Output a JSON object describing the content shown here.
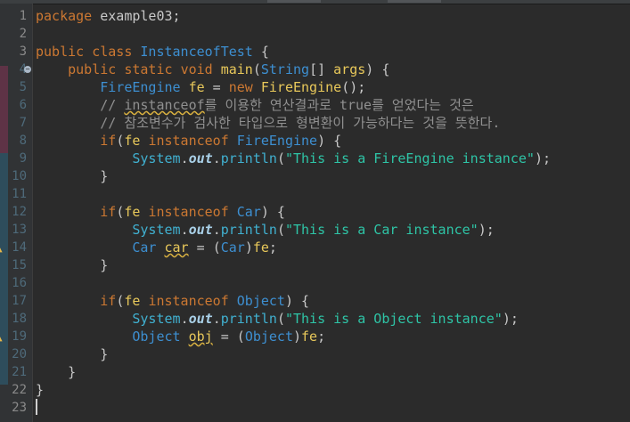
{
  "editor": {
    "line_numbers": [
      "1",
      "2",
      "3",
      "4",
      "5",
      "6",
      "7",
      "8",
      "9",
      "10",
      "11",
      "12",
      "13",
      "14",
      "15",
      "16",
      "17",
      "18",
      "19",
      "20",
      "21",
      "22",
      "23"
    ],
    "lines": {
      "l1": {
        "kw": "package",
        "rest": " example03;"
      },
      "l3": {
        "kw1": "public",
        "kw2": "class",
        "cls": "InstanceofTest",
        "rest": " {"
      },
      "l4": {
        "kw1": "public",
        "kw2": "static",
        "kw3": "void",
        "mth": "main",
        "p1": "(",
        "cls": "String",
        "p2": "[] ",
        "arg": "args",
        "p3": ") {"
      },
      "l5": {
        "cls": "FireEngine",
        "var": "fe",
        "eq": " = ",
        "kw": "new",
        "cls2": "FireEngine",
        "rest": "();"
      },
      "l6": {
        "c1": "// ",
        "c2": "instanceof",
        "c3": "를 이용한 연산결과로 true를 얻었다는 것은"
      },
      "l7": {
        "c": "// 참조변수가 검사한 타입으로 형변환이 가능하다는 것을 뜻한다."
      },
      "l8": {
        "kw": "if",
        "p": "(",
        "var": "fe",
        "kw2": "instanceof",
        "cls": "FireEngine",
        "rest": ") {"
      },
      "l9": {
        "cls": "System",
        "dot1": ".",
        "out": "out",
        "dot2": ".",
        "mth": "println",
        "p1": "(",
        "str": "\"This is a FireEngine instance\"",
        "p2": ");"
      },
      "l10": {
        "t": "}"
      },
      "l12": {
        "kw": "if",
        "p": "(",
        "var": "fe",
        "kw2": "instanceof",
        "cls": "Car",
        "rest": ") {"
      },
      "l13": {
        "cls": "System",
        "dot1": ".",
        "out": "out",
        "dot2": ".",
        "mth": "println",
        "p1": "(",
        "str": "\"This is a Car instance\"",
        "p2": ");"
      },
      "l14": {
        "cls": "Car",
        "var": "car",
        "eq": " = ",
        "p1": "(",
        "cls2": "Car",
        "p2": ")",
        "var2": "fe",
        "rest": ";"
      },
      "l15": {
        "t": "}"
      },
      "l17": {
        "kw": "if",
        "p": "(",
        "var": "fe",
        "kw2": "instanceof",
        "cls": "Object",
        "rest": ") {"
      },
      "l18": {
        "cls": "System",
        "dot1": ".",
        "out": "out",
        "dot2": ".",
        "mth": "println",
        "p1": "(",
        "str": "\"This is a Object instance\"",
        "p2": ");"
      },
      "l19": {
        "cls": "Object",
        "var": "obj",
        "eq": " = ",
        "p1": "(",
        "cls2": "Object",
        "p2": ")",
        "var2": "fe",
        "rest": ";"
      },
      "l20": {
        "t": "}"
      },
      "l21": {
        "t": "}"
      },
      "l22": {
        "t": "}"
      }
    }
  },
  "colors": {
    "background": "#2b2b2b",
    "keyword": "#cc7832",
    "class": "#3d8fd1",
    "string": "#2ec4a6",
    "method": "#e8c85a",
    "comment": "#909090",
    "warning": "#e8b84a"
  },
  "icons": {
    "fold": "fold-collapse-icon",
    "warning": "warning-icon"
  }
}
